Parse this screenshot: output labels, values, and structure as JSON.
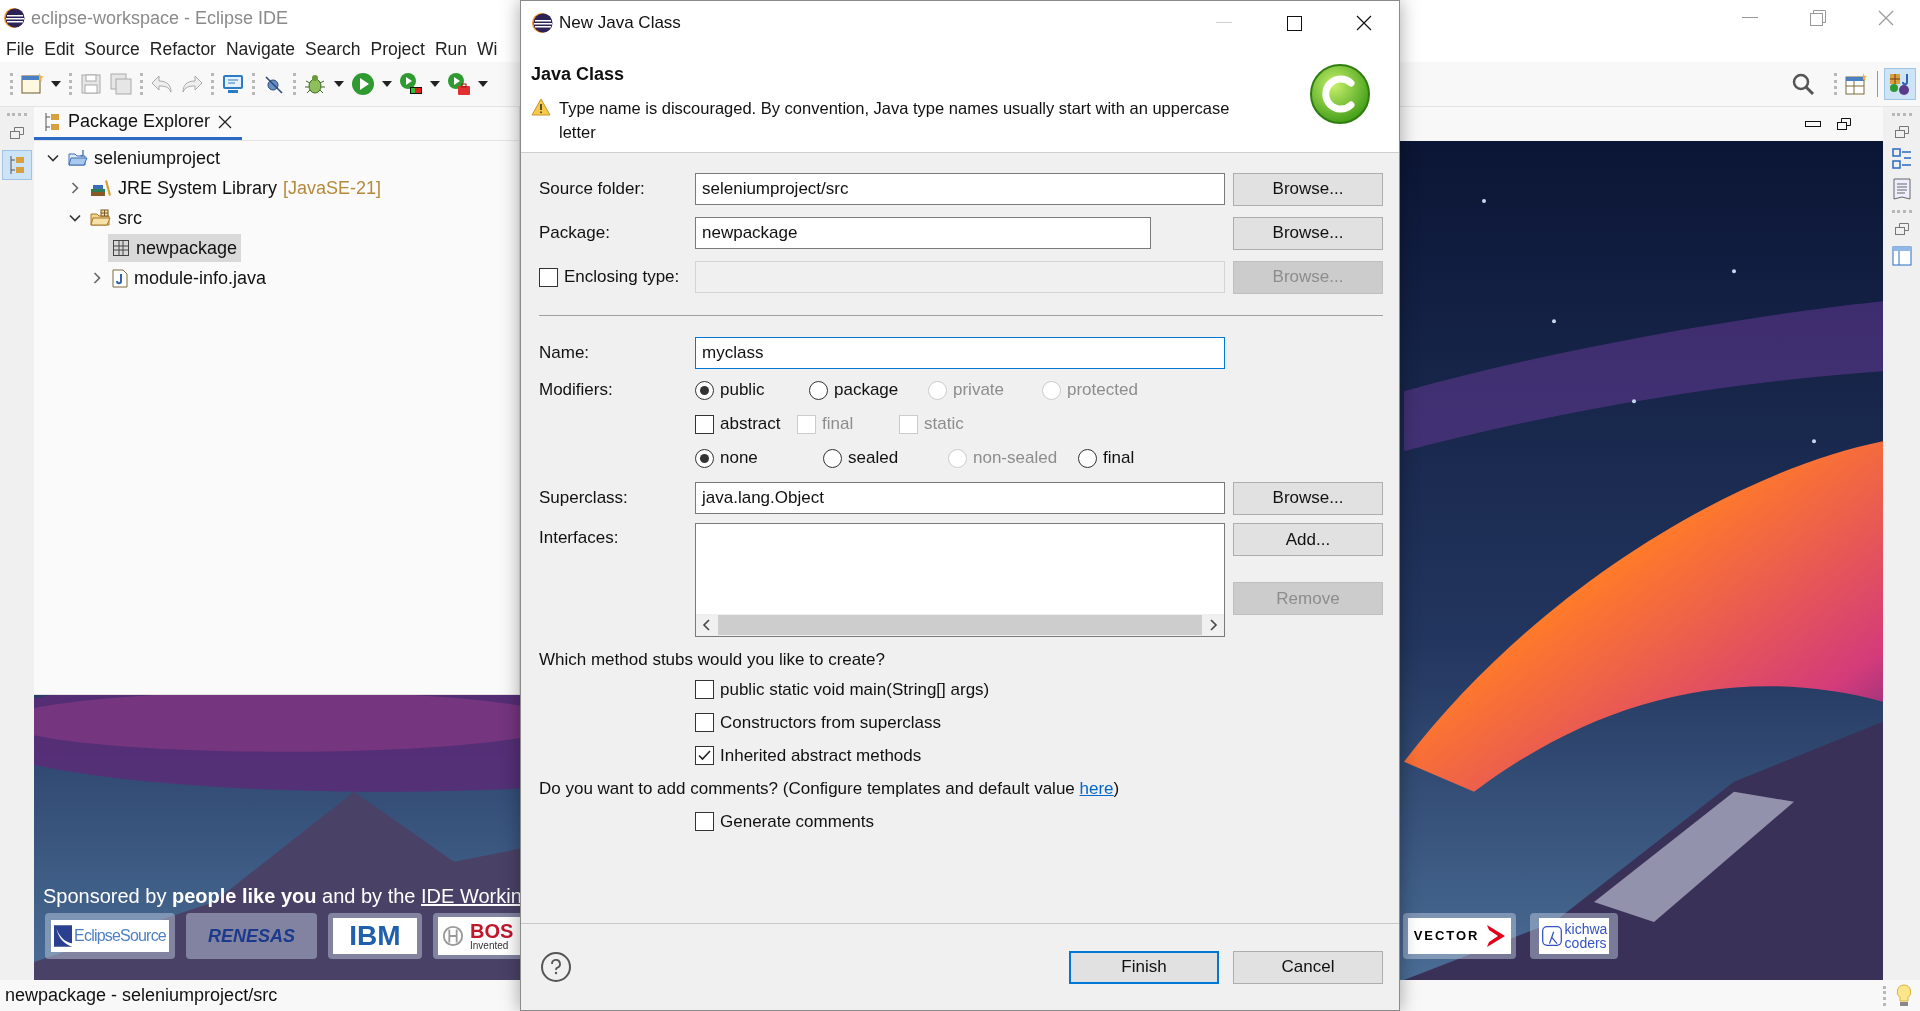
{
  "window": {
    "title": "eclipse-workspace - Eclipse IDE"
  },
  "menu": [
    "File",
    "Edit",
    "Source",
    "Refactor",
    "Navigate",
    "Search",
    "Project",
    "Run",
    "Wi"
  ],
  "package_explorer": {
    "tab": "Package Explorer",
    "tree": [
      {
        "label": "seleniumproject",
        "kind": "project",
        "expanded": true,
        "selected": false,
        "children": [
          {
            "label": "JRE System Library",
            "decoration": "[JavaSE-21]",
            "kind": "library",
            "expanded": false,
            "selected": false
          },
          {
            "label": "src",
            "kind": "folder",
            "expanded": true,
            "selected": false,
            "children": [
              {
                "label": "newpackage",
                "kind": "package",
                "selected": true
              },
              {
                "label": "module-info.java",
                "kind": "file",
                "expanded": false,
                "selected": false
              }
            ]
          }
        ]
      }
    ]
  },
  "welcome": {
    "sponsor_text": "Sponsored by **people like you** and by the ",
    "sponsor_link": "IDE Workin",
    "sponsors_left": [
      {
        "kind": "eclipsesource",
        "text": "EclipseSource"
      },
      {
        "kind": "renesas",
        "text": "RENESAS"
      },
      {
        "kind": "ibm",
        "text": "IBM"
      },
      {
        "kind": "bosch",
        "text": "BOS",
        "subtext": "Invented"
      }
    ],
    "sponsors_right": [
      {
        "kind": "vector",
        "text": "VECTOR"
      },
      {
        "kind": "kichwa",
        "text": "kichwa",
        "subtext": "coders"
      }
    ]
  },
  "dialog": {
    "title": "New Java Class",
    "heading": "Java Class",
    "message": "Type name is discouraged. By convention, Java type names usually start with an uppercase letter",
    "source_folder": {
      "label": "Source folder:",
      "value": "seleniumproject/src",
      "button": "Browse..."
    },
    "package": {
      "label": "Package:",
      "value": "newpackage",
      "button": "Browse..."
    },
    "enclosing_type": {
      "label": "Enclosing type:",
      "checked": false,
      "button": "Browse...",
      "disabled": true
    },
    "name": {
      "label": "Name:",
      "value": "myclass",
      "focused": true
    },
    "modifiers": {
      "label": "Modifiers:",
      "access": [
        {
          "label": "public",
          "selected": true,
          "disabled": false
        },
        {
          "label": "package",
          "selected": false,
          "disabled": false
        },
        {
          "label": "private",
          "selected": false,
          "disabled": true
        },
        {
          "label": "protected",
          "selected": false,
          "disabled": true
        }
      ],
      "flags": [
        {
          "label": "abstract",
          "checked": false,
          "disabled": false
        },
        {
          "label": "final",
          "checked": false,
          "disabled": true
        },
        {
          "label": "static",
          "checked": false,
          "disabled": true
        }
      ],
      "sealing": [
        {
          "label": "none",
          "selected": true,
          "disabled": false
        },
        {
          "label": "sealed",
          "selected": false,
          "disabled": false
        },
        {
          "label": "non-sealed",
          "selected": false,
          "disabled": true
        },
        {
          "label": "final",
          "selected": false,
          "disabled": false
        }
      ]
    },
    "superclass": {
      "label": "Superclass:",
      "value": "java.lang.Object",
      "button": "Browse..."
    },
    "interfaces": {
      "label": "Interfaces:",
      "add_button": "Add...",
      "remove_button": "Remove",
      "remove_disabled": true
    },
    "stubs": {
      "question": "Which method stubs would you like to create?",
      "options": [
        {
          "label": "public static void main(String[] args)",
          "checked": false
        },
        {
          "label": "Constructors from superclass",
          "checked": false
        },
        {
          "label": "Inherited abstract methods",
          "checked": true
        }
      ]
    },
    "comments": {
      "question": "Do you want to add comments? (Configure templates and default value ",
      "link": "here",
      "after": ")",
      "option": {
        "label": "Generate comments",
        "checked": false
      }
    },
    "buttons": [
      {
        "label": "Finish",
        "default": true
      },
      {
        "label": "Cancel",
        "default": false
      }
    ]
  },
  "status_bar": {
    "text": "newpackage - seleniumproject/src"
  }
}
